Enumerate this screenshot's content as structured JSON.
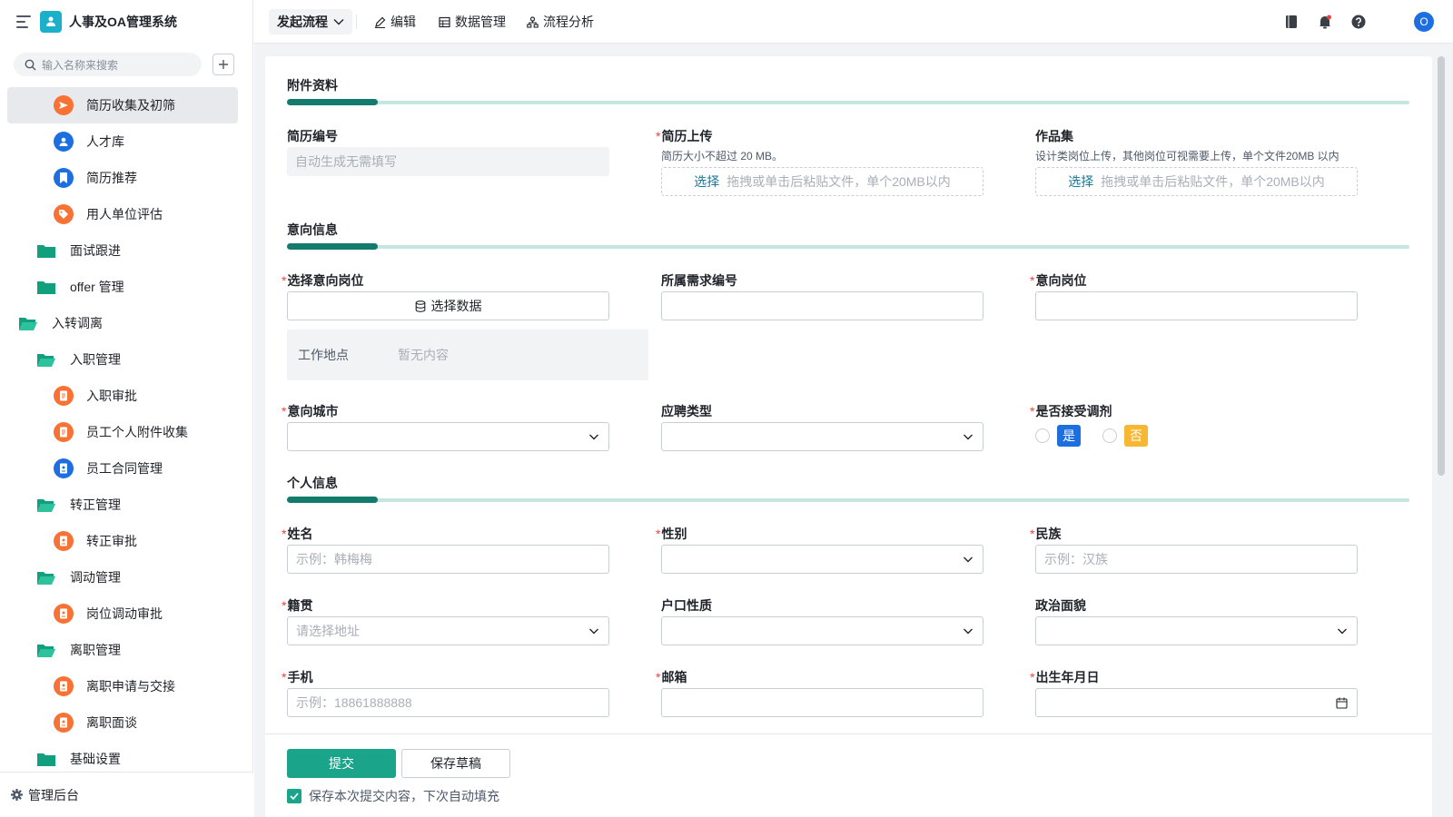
{
  "app": {
    "title": "人事及OA管理系统"
  },
  "sidebar": {
    "search_placeholder": "输入名称来搜索",
    "items": [
      {
        "label": "简历收集及初筛",
        "icon": "send-icon",
        "color": "#f77234",
        "level": 3,
        "active": true
      },
      {
        "label": "人才库",
        "icon": "user-icon",
        "color": "#1d6fe0",
        "level": 3
      },
      {
        "label": "简历推荐",
        "icon": "bookmark-icon",
        "color": "#1d6fe0",
        "level": 3
      },
      {
        "label": "用人单位评估",
        "icon": "tag-icon",
        "color": "#f77234",
        "level": 3
      },
      {
        "label": "面试跟进",
        "icon": "folder-icon",
        "level": 2
      },
      {
        "label": "offer 管理",
        "icon": "folder-icon",
        "level": 2
      },
      {
        "label": "入转调离",
        "icon": "folder-open-icon",
        "level": 1
      },
      {
        "label": "入职管理",
        "icon": "folder-open-icon",
        "level": 2
      },
      {
        "label": "入职审批",
        "icon": "document-icon",
        "color": "#f77234",
        "level": 3
      },
      {
        "label": "员工个人附件收集",
        "icon": "document-icon",
        "color": "#f77234",
        "level": 3
      },
      {
        "label": "员工合同管理",
        "icon": "contract-icon",
        "color": "#1d6fe0",
        "level": 3
      },
      {
        "label": "转正管理",
        "icon": "folder-open-icon",
        "level": 2
      },
      {
        "label": "转正审批",
        "icon": "badge-icon",
        "color": "#f77234",
        "level": 3
      },
      {
        "label": "调动管理",
        "icon": "folder-open-icon",
        "level": 2
      },
      {
        "label": "岗位调动审批",
        "icon": "badge-icon",
        "color": "#f77234",
        "level": 3
      },
      {
        "label": "离职管理",
        "icon": "folder-open-icon",
        "level": 2
      },
      {
        "label": "离职申请与交接",
        "icon": "badge-icon",
        "color": "#f77234",
        "level": 3
      },
      {
        "label": "离职面谈",
        "icon": "badge-icon",
        "color": "#f77234",
        "level": 3
      },
      {
        "label": "基础设置",
        "icon": "folder-icon",
        "level": 2
      }
    ],
    "footer_label": "管理后台"
  },
  "topbar": {
    "start_flow": "发起流程",
    "edit": "编辑",
    "data_manage": "数据管理",
    "flow_analysis": "流程分析",
    "avatar_initial": "O"
  },
  "form": {
    "attachments": {
      "title": "附件资料",
      "resume_no_label": "简历编号",
      "resume_no_placeholder": "自动生成无需填写",
      "resume_upload_label": "简历上传",
      "resume_upload_desc": "简历大小不超过 20 MB。",
      "portfolio_label": "作品集",
      "portfolio_desc": "设计类岗位上传，其他岗位可视需要上传，单个文件20MB 以内",
      "upload_pick": "选择",
      "upload_hint": "拖拽或单击后粘贴文件，单个20MB以内"
    },
    "intent": {
      "title": "意向信息",
      "select_position_label": "选择意向岗位",
      "select_data_btn": "选择数据",
      "demand_no_label": "所属需求编号",
      "position_label": "意向岗位",
      "work_location_key": "工作地点",
      "work_location_value": "暂无内容",
      "city_label": "意向城市",
      "apply_type_label": "应聘类型",
      "accept_transfer_label": "是否接受调剂",
      "yes": "是",
      "no": "否"
    },
    "personal": {
      "title": "个人信息",
      "name_label": "姓名",
      "name_placeholder": "示例：韩梅梅",
      "gender_label": "性别",
      "ethnicity_label": "民族",
      "ethnicity_placeholder": "示例：汉族",
      "native_label": "籍贯",
      "native_placeholder": "请选择地址",
      "hukou_label": "户口性质",
      "political_label": "政治面貌",
      "phone_label": "手机",
      "phone_placeholder": "示例：18861888888",
      "email_label": "邮箱",
      "birth_label": "出生年月日"
    }
  },
  "actions": {
    "submit": "提交",
    "save_draft": "保存草稿",
    "autofill": "保存本次提交内容，下次自动填充"
  },
  "colors": {
    "accent": "#1aa58a",
    "section_bar": "#137a6e",
    "yes_tag": "#1d6fe0",
    "no_tag": "#f7b733",
    "required": "#f53f3f"
  }
}
